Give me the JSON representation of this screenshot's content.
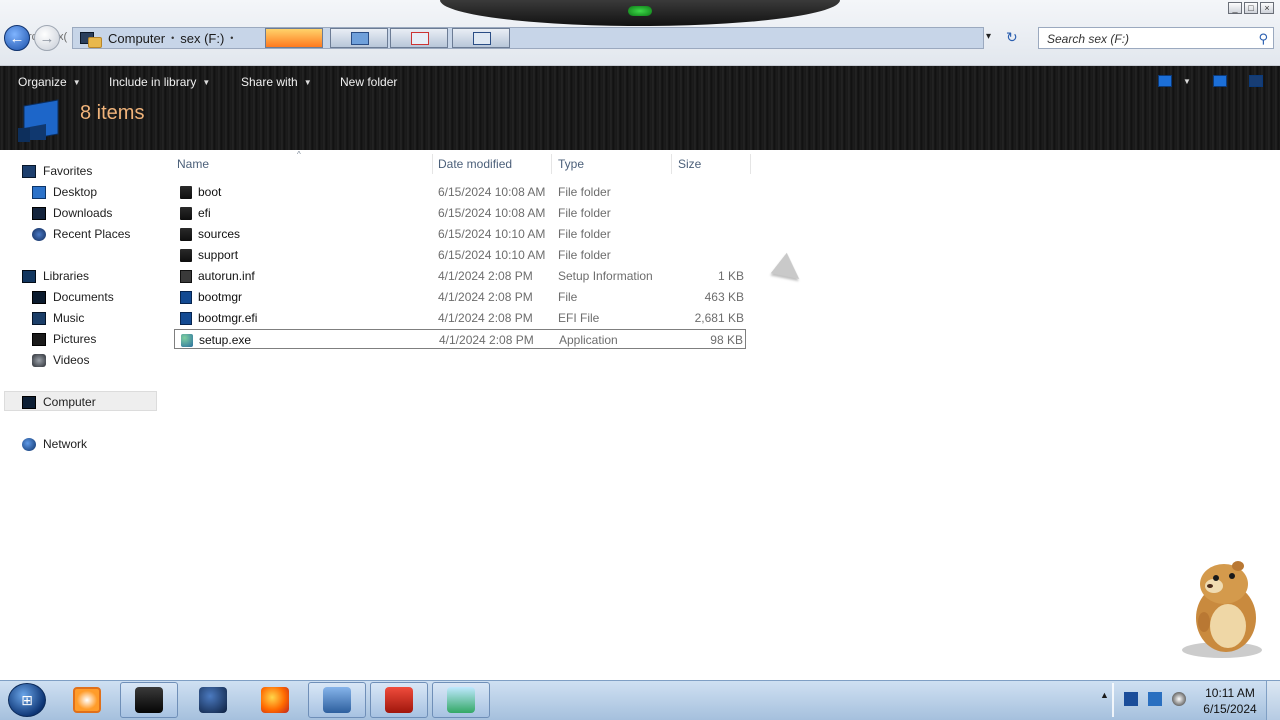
{
  "window": {
    "minimize_label": "0",
    "maximize_label": "1",
    "close_label": "r"
  },
  "address_bar": {
    "back_icon": "back-arrow-icon",
    "forward_icon": "forward-arrow-icon",
    "ghost_text": "rch sex(",
    "crumbs": [
      "Computer",
      "sex (F:)"
    ],
    "separator": "•",
    "dropdown": "▾",
    "refresh": "↻"
  },
  "search": {
    "placeholder": "Search sex (F:)",
    "icon": "search-icon"
  },
  "toolbar": {
    "organize": "Organize",
    "include_in_library": "Include in library",
    "share_with": "Share with",
    "new_folder": "New folder",
    "dropdown_arrow": "▼",
    "item_count": "8 items"
  },
  "nav": {
    "favorites": "Favorites",
    "desktop": "Desktop",
    "downloads": "Downloads",
    "recent_places": "Recent Places",
    "libraries": "Libraries",
    "documents": "Documents",
    "music": "Music",
    "pictures": "Pictures",
    "videos": "Videos",
    "computer": "Computer",
    "network": "Network"
  },
  "columns": {
    "name": "Name",
    "date_modified": "Date modified",
    "type": "Type",
    "size": "Size",
    "sort_caret": "^"
  },
  "files": [
    {
      "name": "boot",
      "date": "6/15/2024 10:08 AM",
      "type": "File folder",
      "size": "",
      "icon": "folder-icon"
    },
    {
      "name": "efi",
      "date": "6/15/2024 10:08 AM",
      "type": "File folder",
      "size": "",
      "icon": "folder-icon"
    },
    {
      "name": "sources",
      "date": "6/15/2024 10:10 AM",
      "type": "File folder",
      "size": "",
      "icon": "folder-icon"
    },
    {
      "name": "support",
      "date": "6/15/2024 10:10 AM",
      "type": "File folder",
      "size": "",
      "icon": "folder-icon"
    },
    {
      "name": "autorun.inf",
      "date": "4/1/2024 2:08 PM",
      "type": "Setup Information",
      "size": "1 KB",
      "icon": "setup-info-icon"
    },
    {
      "name": "bootmgr",
      "date": "4/1/2024 2:08 PM",
      "type": "File",
      "size": "463 KB",
      "icon": "system-file-icon"
    },
    {
      "name": "bootmgr.efi",
      "date": "4/1/2024 2:08 PM",
      "type": "EFI File",
      "size": "2,681 KB",
      "icon": "system-file-icon"
    },
    {
      "name": "setup.exe",
      "date": "4/1/2024 2:08 PM",
      "type": "Application",
      "size": "98 KB",
      "icon": "setup-exe-icon"
    }
  ],
  "taskbar": {
    "start_icon": "windows-start-orb-icon",
    "apps": [
      "media-player-icon",
      "terminal-icon",
      "globe-icon",
      "firefox-icon",
      "network-icon",
      "toolbox-icon",
      "image-viewer-icon"
    ],
    "tray_up": "▲",
    "clock_time": "10:11 AM",
    "clock_date": "6/15/2024"
  }
}
